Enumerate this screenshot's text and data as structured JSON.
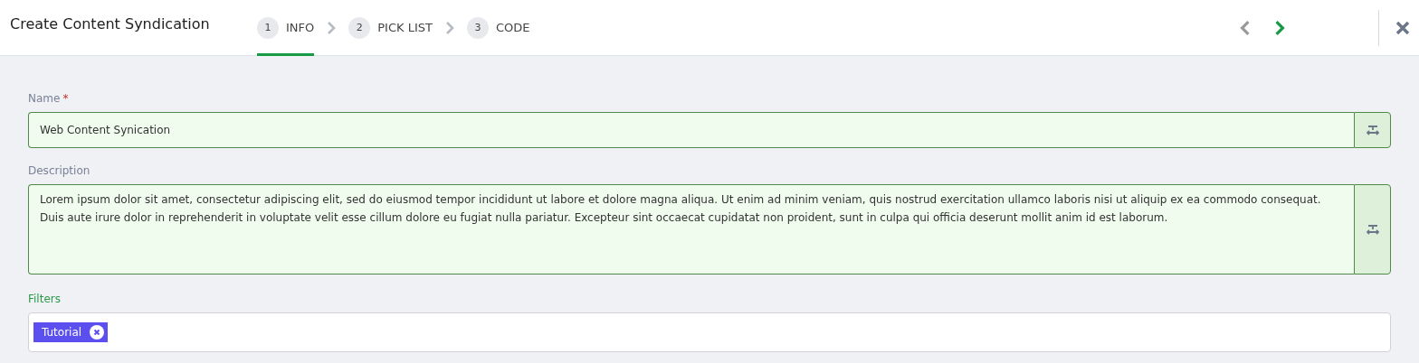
{
  "title": "Create Content Syndication",
  "steps": [
    {
      "number": "1",
      "label": "INFO",
      "selected": true
    },
    {
      "number": "2",
      "label": "PICK LIST",
      "selected": false
    },
    {
      "number": "3",
      "label": "CODE",
      "selected": false
    }
  ],
  "nav": {
    "prev_disabled": true,
    "next_disabled": false
  },
  "form": {
    "name": {
      "label": "Name",
      "required_mark": "*",
      "value": "Web Content Synication"
    },
    "description": {
      "label": "Description",
      "value": "Lorem ipsum dolor sit amet, consectetur adipiscing elit, sed do eiusmod tempor incididunt ut labore et dolore magna aliqua. Ut enim ad minim veniam, quis nostrud exercitation ullamco laboris nisi ut aliquip ex ea commodo consequat. Duis aute irure dolor in reprehenderit in voluptate velit esse cillum dolore eu fugiat nulla pariatur. Excepteur sint occaecat cupidatat non proident, sunt in culpa qui officia deserunt mollit anim id est laborum."
    },
    "filters": {
      "label": "Filters",
      "focused": true,
      "tags": [
        "Tutorial"
      ]
    }
  }
}
